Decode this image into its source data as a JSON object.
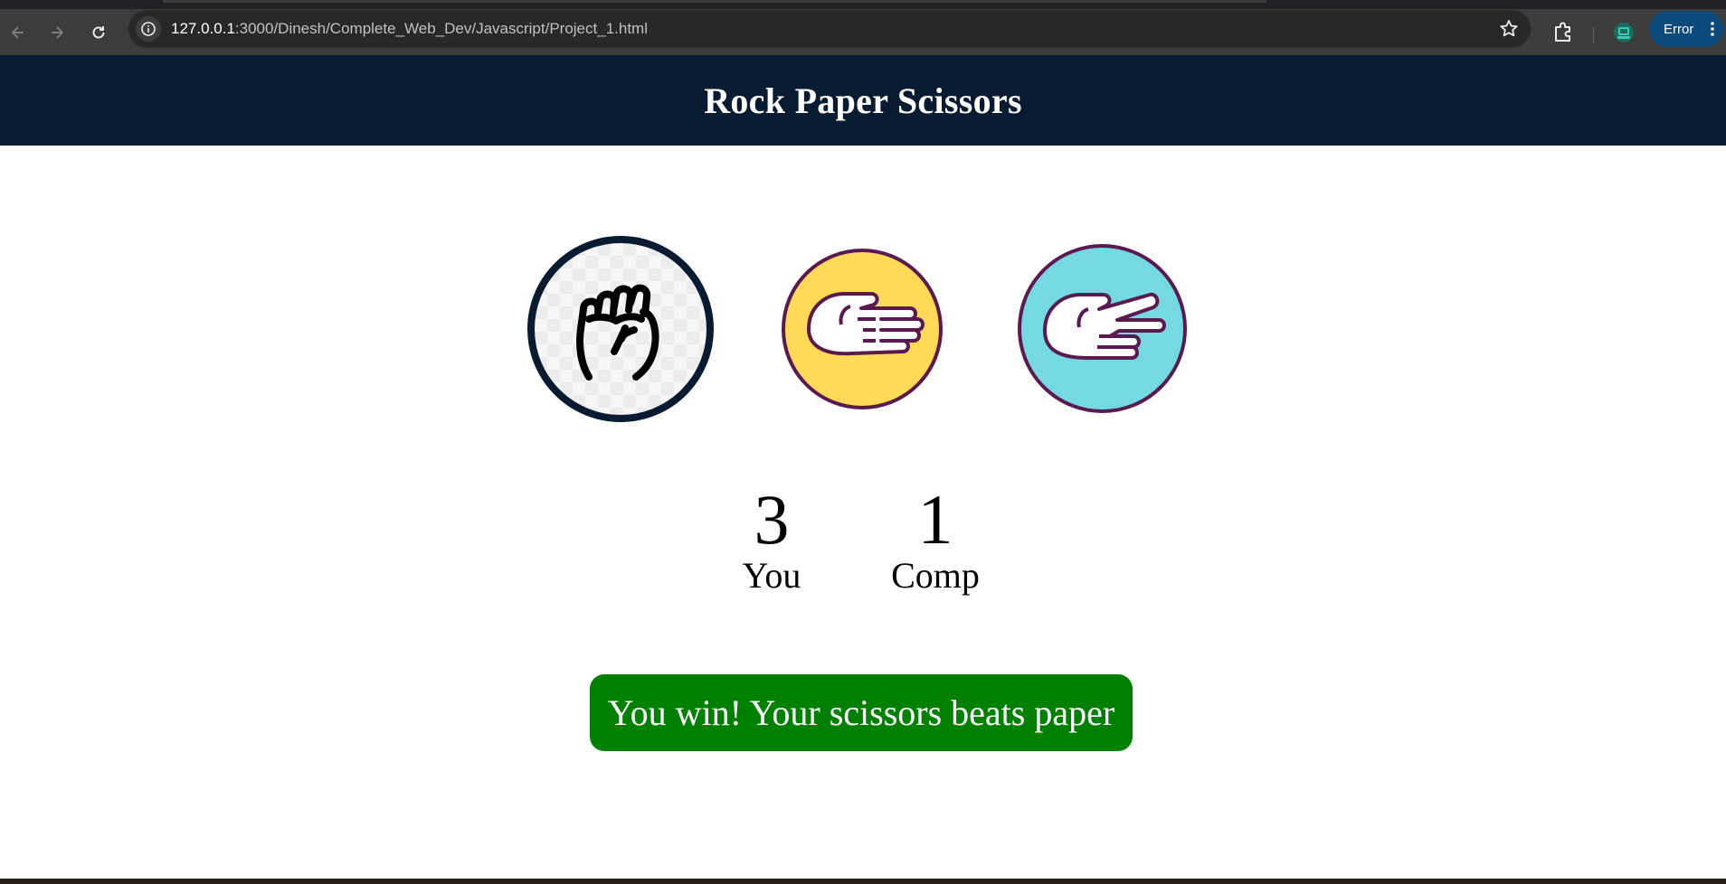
{
  "browser": {
    "url_host": "127.0.0.1",
    "url_path": ":3000/Dinesh/Complete_Web_Dev/Javascript/Project_1.html",
    "status_label": "Error",
    "icons": [
      "back-icon",
      "forward-icon",
      "reload-icon",
      "site-info-icon",
      "bookmark-star-icon",
      "extensions-icon",
      "profile-icon",
      "more-menu-icon"
    ]
  },
  "page": {
    "title": "Rock Paper Scissors",
    "choices": [
      {
        "id": "rock",
        "icon": "fist-icon",
        "circle_color": "#f7f7f7",
        "border_color": "#081b31"
      },
      {
        "id": "paper",
        "icon": "flat-hand-icon",
        "circle_color": "#ffda57",
        "border_color": "#5b1a4f"
      },
      {
        "id": "scissors",
        "icon": "two-finger-hand-icon",
        "circle_color": "#74d9e1",
        "border_color": "#5b1a4f"
      }
    ],
    "scores": {
      "user_score": "3",
      "user_label": "You",
      "comp_score": "1",
      "comp_label": "Comp"
    },
    "message": {
      "text": "You win! Your scissors beats paper",
      "color": "#008000"
    },
    "header_color": "#081b31"
  }
}
